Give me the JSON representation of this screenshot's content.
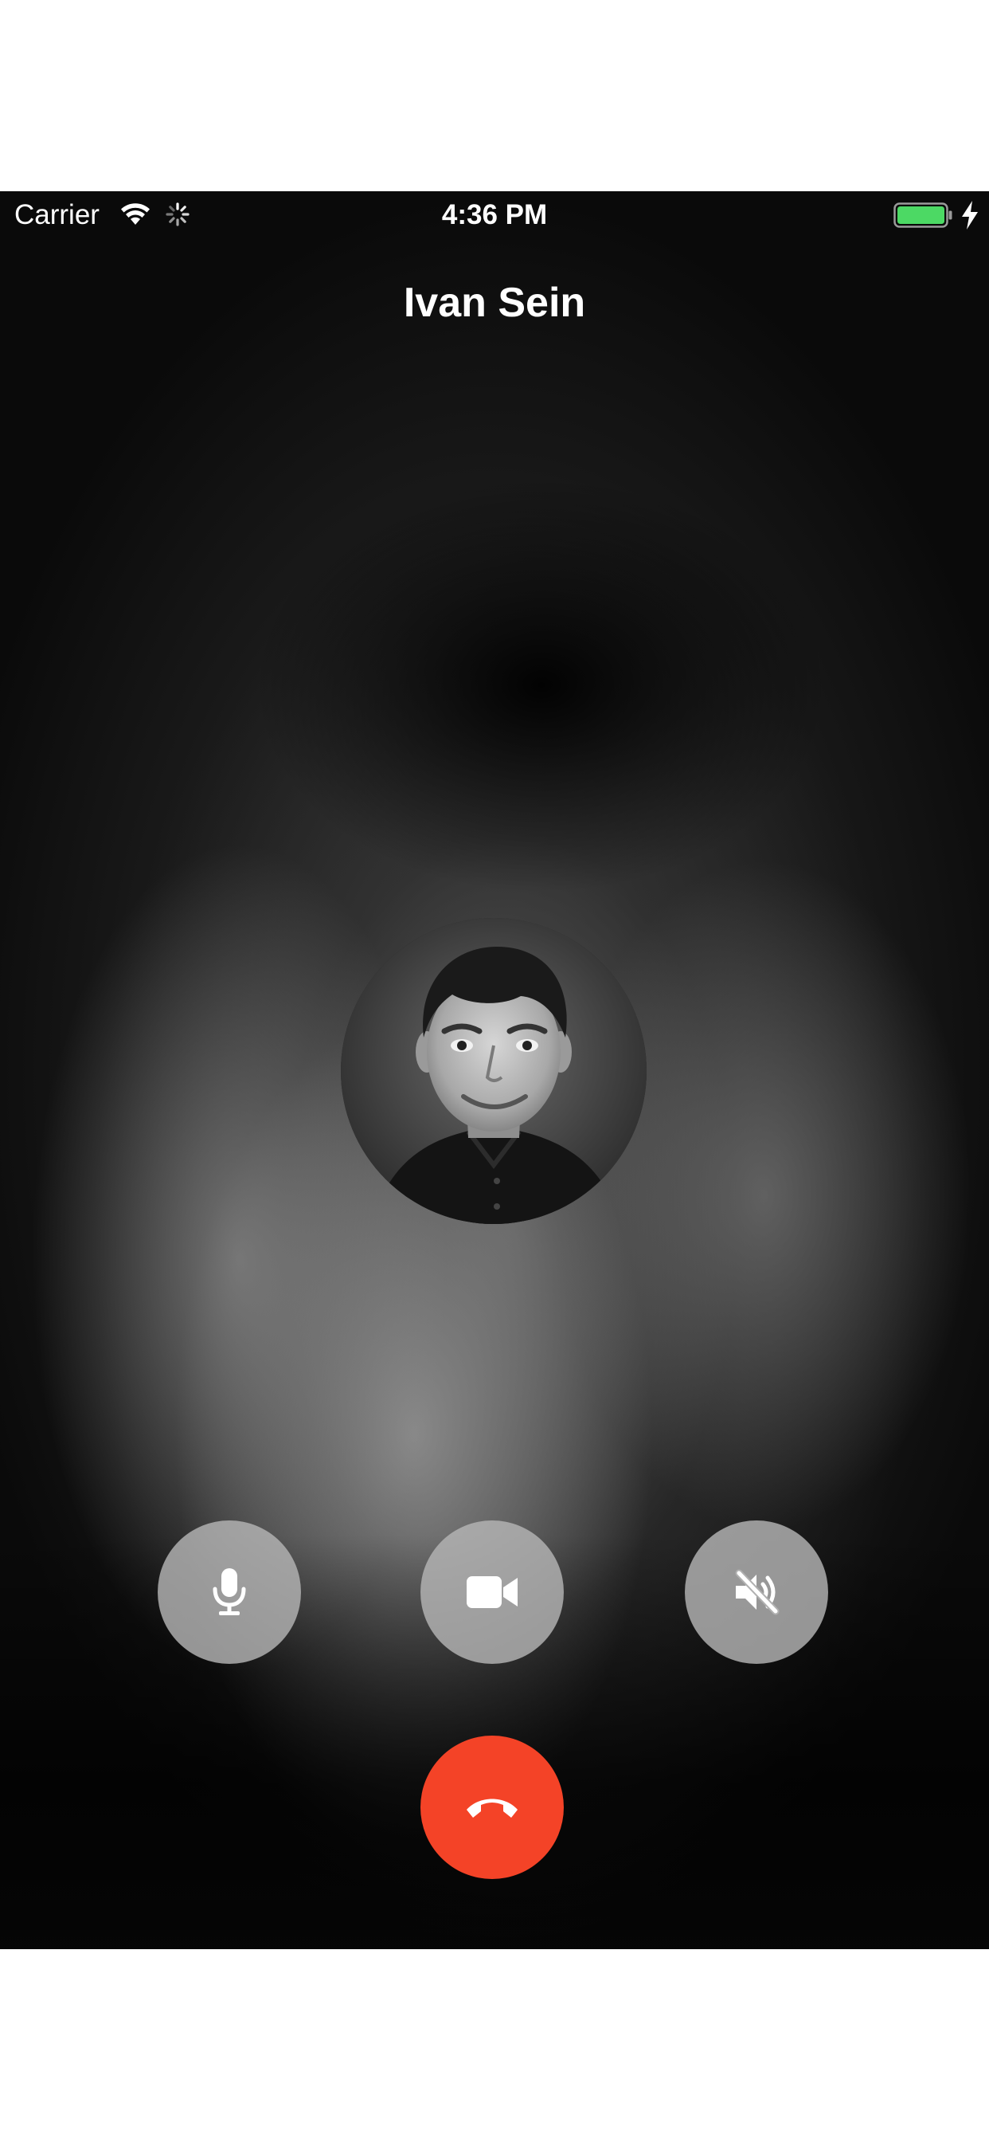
{
  "status_bar": {
    "carrier": "Carrier",
    "time": "4:36 PM",
    "icons": [
      "wifi-icon",
      "activity-spinner-icon",
      "battery-icon",
      "charging-bolt-icon"
    ],
    "battery_color": "#4cd964"
  },
  "call": {
    "caller_name": "Ivan Sein",
    "avatar": "caller-avatar",
    "controls": [
      {
        "name": "microphone",
        "icon": "microphone-icon"
      },
      {
        "name": "video",
        "icon": "video-camera-icon"
      },
      {
        "name": "speaker",
        "icon": "speaker-muted-icon"
      }
    ],
    "end_call": {
      "icon": "hang-up-phone-icon",
      "color": "#f44327"
    }
  }
}
